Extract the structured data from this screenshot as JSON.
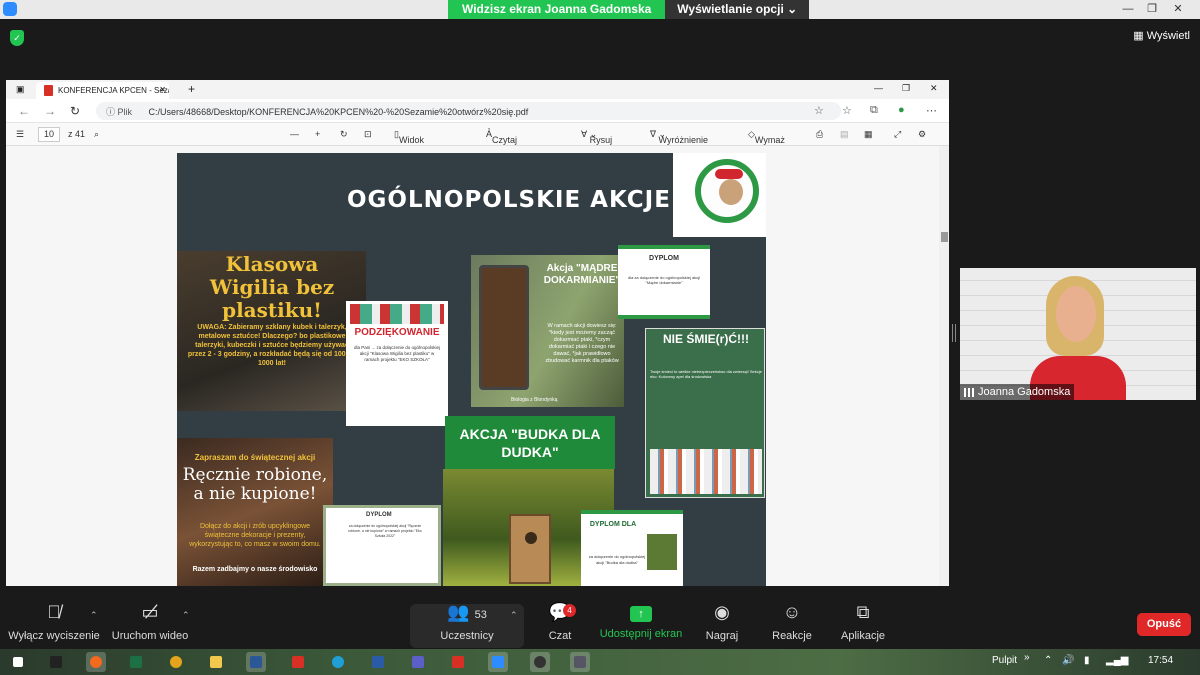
{
  "zoom": {
    "share_banner": "Widzisz ekran Joanna Gadomska",
    "view_options": "Wyświetlanie opcji",
    "view_button": "Wyświetl",
    "participant_name": "Joanna Gadomska",
    "controls": {
      "mute": "Wyłącz wyciszenie",
      "video": "Uruchom wideo",
      "participants": "Uczestnicy",
      "participants_count": "53",
      "chat": "Czat",
      "chat_badge": "4",
      "share": "Udostępnij ekran",
      "record": "Nagraj",
      "reactions": "Reakcje",
      "apps": "Aplikacje",
      "leave": "Opuść"
    }
  },
  "browser": {
    "tab_title": "KONFERENCJA KPCEN - Sezamie",
    "address_prefix": "Plik",
    "address": "C:/Users/48668/Desktop/KONFERENCJA%20KPCEN%20-%20Sezamie%20otwórz%20się.pdf"
  },
  "pdf_toolbar": {
    "page_current": "10",
    "page_total": "z 41",
    "page_view": "Widok strony",
    "read_aloud": "Czytaj na głos",
    "draw": "Rysuj",
    "highlight": "Wyróżnienie",
    "erase": "Wymaż"
  },
  "slide": {
    "title": "OGÓLNOPOLSKIE AKCJE",
    "wigilia_title": "Klasowa Wigilia bez plastiku!",
    "wigilia_text": "UWAGA: Zabieramy szklany kubek i talerzyk, metalowe sztućce! Dlaczego? bo plastikowe talerzyki, kubeczki i sztućce będziemy używać przez 2 - 3 godziny, a rozkładać będą się od 100 do 1000 lat!",
    "podziekowanie_title": "PODZIĘKOWANIE",
    "podziekowanie_text": "dla Pani ... za dołączenie do ogólnopolskiej akcji \"Klasowa Wigilia bez plastiku\" w ramach projektu \"EKO SZKOŁA\"",
    "karmienie_title": "Akcja \"MĄDRE DOKARMIANIE\"",
    "karmienie_text": "W ramach akcji dowiesz się: *kiedy jest możemy zacząć dokarmiać ptaki, *czym dokarmiać ptaki i czego nie dawać, *jak prawidłowo zbudować karmnik dla ptaków",
    "karmienie_sign": "Biologia z Blondynką",
    "dyplom1_title": "DYPLOM",
    "dyplom1_text": "dla za dołączenie do ogólnopolskiej akcji \"Mądre dokarmianie\"",
    "smie_title": "NIE ŚMIE(r)Ć!!!",
    "smie_text": "Twoje śmieci to wielkie niebezpieczeństwo dla zwierząt! Sekcje eko: Kolorowy apel dla środowiska",
    "budka_title": "AKCJA \"BUDKA DLA DUDKA\"",
    "reczne_intro": "Zapraszam do świątecznej akcji",
    "reczne_title": "Ręcznie robione, a nie kupione!",
    "reczne_text": "Dołącz do akcji i zrób upcyklingowe świąteczne dekoracje i prezenty, wykorzystując to, co masz w swoim domu.",
    "reczne_footer": "Razem zadbajmy o nasze środowisko",
    "dyplom2_title": "DYPLOM",
    "dyplom2_text": "za dołączenie do ogólnopolskiej akcji \"Ręcznie robione, a nie kupione\" w ramach projektu \"Eko Szkoła 2022\"",
    "dyplom3_title": "DYPLOM DLA",
    "dyplom3_text": "za dołączenie do ogólnopolskiej akcji \"Budka dla dudka\""
  },
  "taskbar": {
    "desktop": "Pulpit",
    "time": "17:54"
  }
}
